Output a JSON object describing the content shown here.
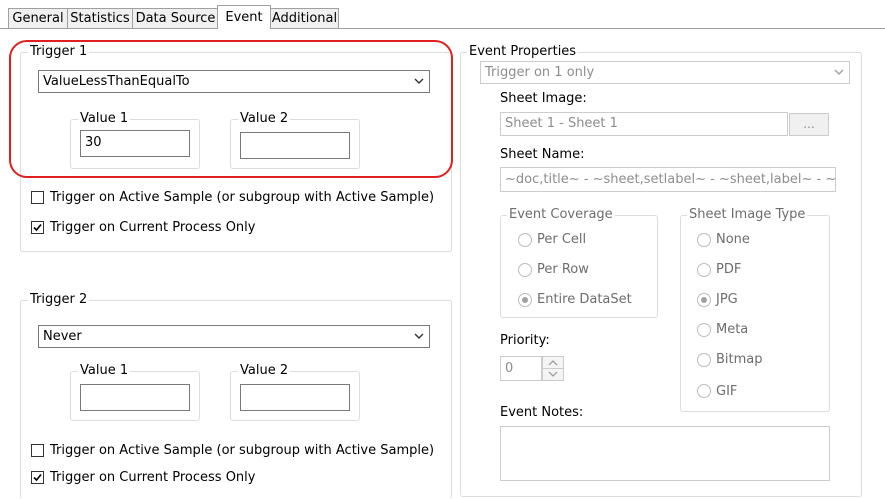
{
  "tabs": [
    "General",
    "Statistics",
    "Data Source",
    "Event",
    "Additional"
  ],
  "trigger1": {
    "legend": "Trigger 1",
    "condition": "ValueLessThanEqualTo",
    "value1_label": "Value 1",
    "value1": "30",
    "value2_label": "Value 2",
    "value2": "",
    "active_sample_label": "Trigger on Active Sample (or subgroup with Active Sample)",
    "active_sample_checked": false,
    "current_process_label": "Trigger on Current Process Only",
    "current_process_checked": true
  },
  "trigger2": {
    "legend": "Trigger 2",
    "condition": "Never",
    "value1_label": "Value 1",
    "value1": "",
    "value2_label": "Value 2",
    "value2": "",
    "active_sample_label": "Trigger on Active Sample (or subgroup with Active Sample)",
    "active_sample_checked": false,
    "current_process_label": "Trigger on Current Process Only",
    "current_process_checked": true
  },
  "event_properties": {
    "legend": "Event Properties",
    "trigger_mode": "Trigger on 1 only",
    "sheet_image_label": "Sheet Image:",
    "sheet_image_value": "Sheet 1 - Sheet 1",
    "browse_label": "...",
    "sheet_name_label": "Sheet Name:",
    "sheet_name_value": "~doc,title~ - ~sheet,setlabel~ - ~sheet,label~ - ~date~",
    "event_coverage": {
      "legend": "Event Coverage",
      "options": [
        "Per Cell",
        "Per Row",
        "Entire DataSet"
      ],
      "selected": "Entire DataSet"
    },
    "sheet_image_type": {
      "legend": "Sheet Image Type",
      "options": [
        "None",
        "PDF",
        "JPG",
        "Meta",
        "Bitmap",
        "GIF"
      ],
      "selected": "JPG"
    },
    "priority_label": "Priority:",
    "priority_value": "0",
    "event_notes_label": "Event Notes:",
    "event_notes_value": ""
  },
  "colors": {
    "highlight": "#e02020",
    "disabled_text": "#8d8d8d"
  }
}
